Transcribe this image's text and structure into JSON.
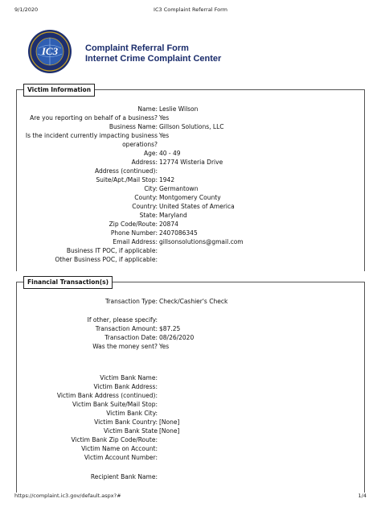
{
  "print_header": {
    "date": "9/1/2020",
    "title": "IC3 Complaint Referral Form"
  },
  "print_footer": {
    "url": "https://complaint.ic3.gov/default.aspx?#",
    "page": "1/4"
  },
  "logo": {
    "text": "IC3"
  },
  "heading": {
    "line1": "Complaint Referral Form",
    "line2": "Internet Crime Complaint Center"
  },
  "victim_information": {
    "label": "Victim Information",
    "fields": [
      {
        "label": "Name:",
        "value": "Leslie Wilson"
      },
      {
        "label": "Are you reporting on behalf of a business?",
        "value": "Yes"
      },
      {
        "label": "Business Name:",
        "value": "Gillson Solutions, LLC"
      },
      {
        "label": "Is the incident currently impacting business operations?",
        "value": "Yes"
      },
      {
        "label": "Age:",
        "value": "40 - 49"
      },
      {
        "label": "Address:",
        "value": "12774 Wisteria Drive"
      },
      {
        "label": "Address (continued):",
        "value": ""
      },
      {
        "label": "Suite/Apt./Mail Stop:",
        "value": "1942"
      },
      {
        "label": "City:",
        "value": "Germantown"
      },
      {
        "label": "County:",
        "value": "Montgomery County"
      },
      {
        "label": "Country:",
        "value": "United States of America"
      },
      {
        "label": "State:",
        "value": "Maryland"
      },
      {
        "label": "Zip Code/Route:",
        "value": "20874"
      },
      {
        "label": "Phone Number:",
        "value": "2407086345"
      },
      {
        "label": "Email Address:",
        "value": "gillsonsolutions@gmail.com"
      },
      {
        "label": "Business IT POC, if applicable:",
        "value": ""
      },
      {
        "label": "Other Business POC, if applicable:",
        "value": ""
      }
    ]
  },
  "financial_transactions": {
    "label": "Financial Transaction(s)",
    "fields": [
      {
        "label": "Transaction Type:",
        "value": "Check/Cashier's Check"
      },
      {
        "label": "If other, please specify:",
        "value": ""
      },
      {
        "label": "Transaction Amount:",
        "value": "$87.25"
      },
      {
        "label": "Transaction Date:",
        "value": "08/26/2020"
      },
      {
        "label": "Was the money sent?",
        "value": "Yes"
      },
      {
        "label": "Victim Bank Name:",
        "value": ""
      },
      {
        "label": "Victim Bank Address:",
        "value": ""
      },
      {
        "label": "Victim Bank Address (continued):",
        "value": ""
      },
      {
        "label": "Victim Bank Suite/Mail Stop:",
        "value": ""
      },
      {
        "label": "Victim Bank City:",
        "value": ""
      },
      {
        "label": "Victim Bank Country:",
        "value": "[None]"
      },
      {
        "label": "Victim Bank State",
        "value": "[None]"
      },
      {
        "label": "Victim Bank Zip Code/Route:",
        "value": ""
      },
      {
        "label": "Victim Name on Account:",
        "value": ""
      },
      {
        "label": "Victim Account Number:",
        "value": ""
      },
      {
        "label": "Recipient Bank Name:",
        "value": ""
      }
    ]
  }
}
